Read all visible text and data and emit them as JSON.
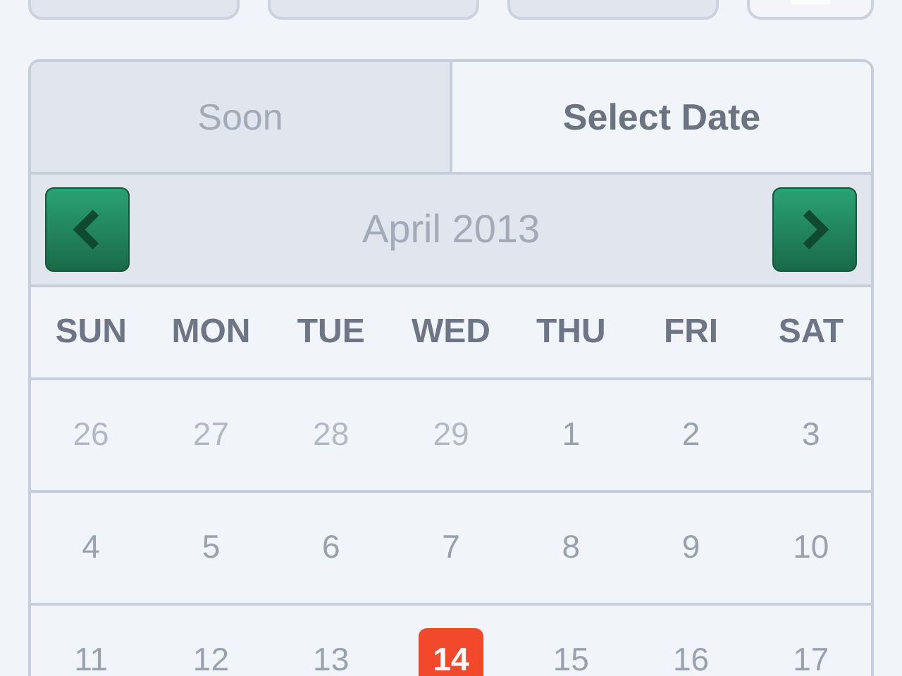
{
  "top_buttons": [
    {
      "kind": "plain"
    },
    {
      "kind": "plain"
    },
    {
      "kind": "plain"
    },
    {
      "kind": "icon"
    }
  ],
  "tabs": [
    {
      "label": "Soon",
      "selected": false
    },
    {
      "label": "Select Date",
      "selected": true
    }
  ],
  "calendar": {
    "month": "April 2013",
    "weekdays": [
      "SUN",
      "MON",
      "TUE",
      "WED",
      "THU",
      "FRI",
      "SAT"
    ],
    "weeks": [
      [
        {
          "label": "26",
          "muted": true,
          "selected": false
        },
        {
          "label": "27",
          "muted": true,
          "selected": false
        },
        {
          "label": "28",
          "muted": true,
          "selected": false
        },
        {
          "label": "29",
          "muted": true,
          "selected": false
        },
        {
          "label": "1",
          "muted": false,
          "selected": false
        },
        {
          "label": "2",
          "muted": false,
          "selected": false
        },
        {
          "label": "3",
          "muted": false,
          "selected": false
        }
      ],
      [
        {
          "label": "4",
          "muted": false,
          "selected": false
        },
        {
          "label": "5",
          "muted": false,
          "selected": false
        },
        {
          "label": "6",
          "muted": false,
          "selected": false
        },
        {
          "label": "7",
          "muted": false,
          "selected": false
        },
        {
          "label": "8",
          "muted": false,
          "selected": false
        },
        {
          "label": "9",
          "muted": false,
          "selected": false
        },
        {
          "label": "10",
          "muted": false,
          "selected": false
        }
      ],
      [
        {
          "label": "11",
          "muted": false,
          "selected": false
        },
        {
          "label": "12",
          "muted": false,
          "selected": false
        },
        {
          "label": "13",
          "muted": false,
          "selected": false
        },
        {
          "label": "14",
          "muted": false,
          "selected": true
        },
        {
          "label": "15",
          "muted": false,
          "selected": false
        },
        {
          "label": "16",
          "muted": false,
          "selected": false
        },
        {
          "label": "17",
          "muted": false,
          "selected": false
        }
      ]
    ]
  }
}
